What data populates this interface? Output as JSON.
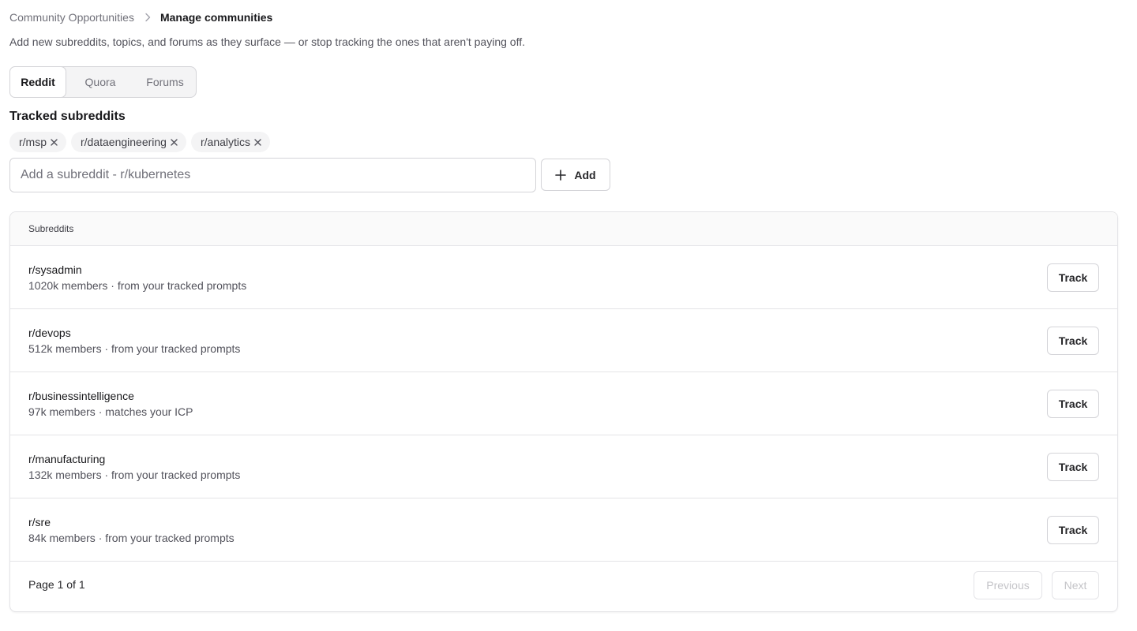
{
  "breadcrumb": {
    "parent": "Community Opportunities",
    "current": "Manage communities"
  },
  "description": "Add new subreddits, topics, and forums as they surface — or stop tracking the ones that aren't paying off.",
  "tabs": [
    {
      "label": "Reddit",
      "active": true
    },
    {
      "label": "Quora",
      "active": false
    },
    {
      "label": "Forums",
      "active": false
    }
  ],
  "tracked": {
    "title": "Tracked subreddits",
    "chips": [
      "r/msp",
      "r/dataengineering",
      "r/analytics"
    ]
  },
  "add_form": {
    "placeholder": "Add a subreddit - r/kubernetes",
    "value": "",
    "button_label": "Add"
  },
  "table": {
    "header": "Subreddits",
    "rows": [
      {
        "name": "r/sysadmin",
        "meta": "1020k members · from your tracked prompts",
        "action": "Track"
      },
      {
        "name": "r/devops",
        "meta": "512k members · from your tracked prompts",
        "action": "Track"
      },
      {
        "name": "r/businessintelligence",
        "meta": "97k members · matches your ICP",
        "action": "Track"
      },
      {
        "name": "r/manufacturing",
        "meta": "132k members · from your tracked prompts",
        "action": "Track"
      },
      {
        "name": "r/sre",
        "meta": "84k members · from your tracked prompts",
        "action": "Track"
      }
    ]
  },
  "pagination": {
    "page_info": "Page 1 of 1",
    "previous_label": "Previous",
    "next_label": "Next"
  },
  "icons": {
    "breadcrumb_separator": "chevron-right-icon",
    "chip_remove": "close-icon",
    "add": "plus-icon"
  },
  "colors": {
    "text_primary": "#18181b",
    "text_muted": "#71717a",
    "border": "#d4d4d8",
    "chip_bg": "#f4f4f5",
    "header_bg": "#fafafa",
    "disabled_text": "#c4c4c8"
  }
}
